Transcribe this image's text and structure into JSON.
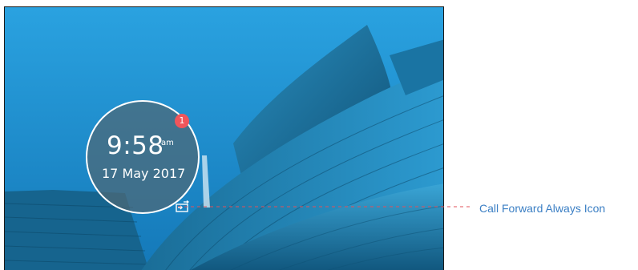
{
  "device_screen": {
    "clock": {
      "time": "9:58",
      "ampm": "am",
      "date": "17 May 2017"
    },
    "notification_badge": {
      "count": "1",
      "color": "#f0555b"
    },
    "status_icons": [
      {
        "icon": "call-forward-always-icon"
      }
    ],
    "wallpaper": {
      "sky_color": "#1f93d3",
      "building_color": "#1b6e96"
    }
  },
  "annotation": {
    "label": "Call Forward Always Icon",
    "label_color": "#3b7fc4",
    "leader_color": "#e0505a"
  }
}
